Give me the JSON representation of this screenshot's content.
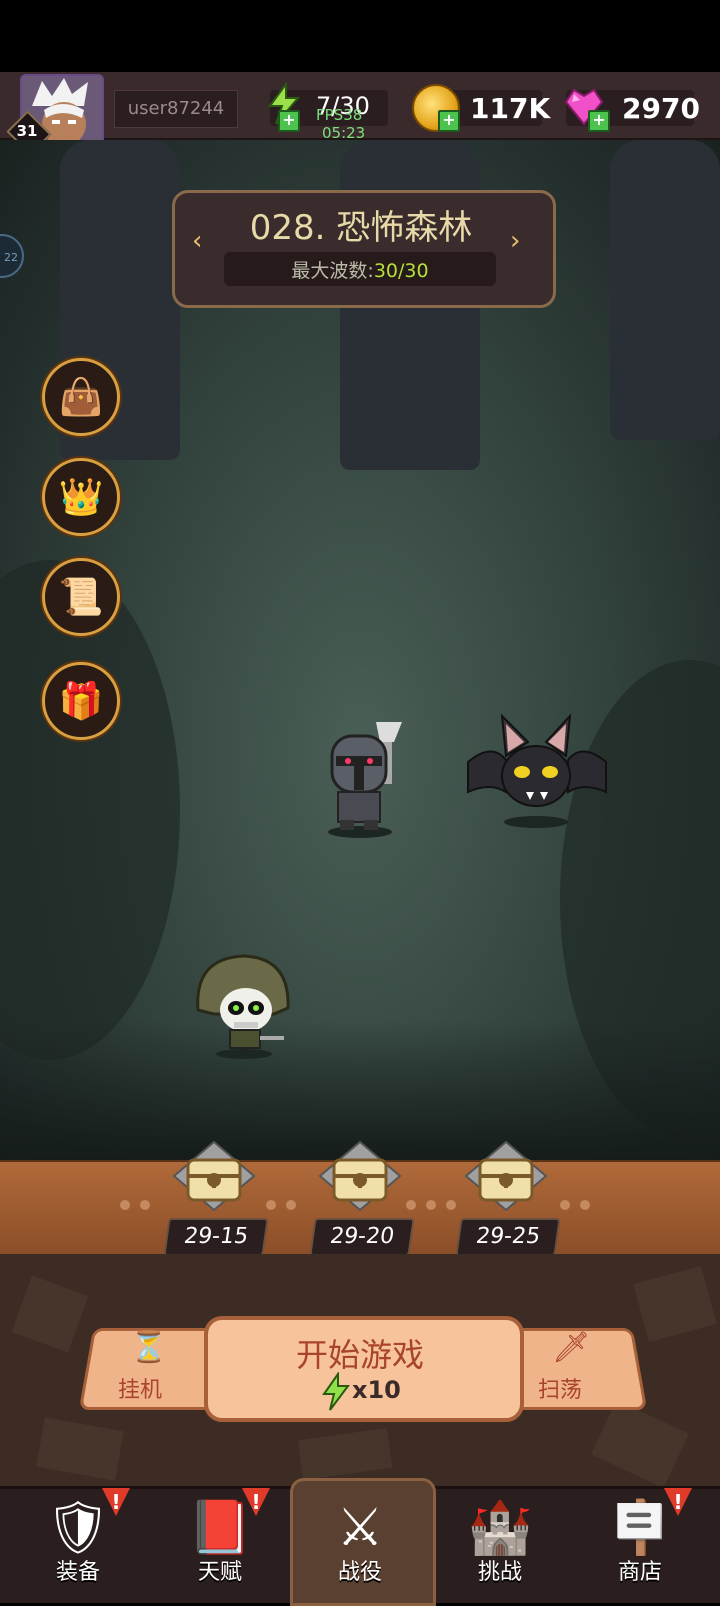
{
  "header": {
    "player_level": "31",
    "username": "user87244",
    "energy": "7/30",
    "fps": "FPS38",
    "energy_timer": "05:23",
    "coins": "117K",
    "gems": "2970"
  },
  "stage_info": {
    "name": "028. 恐怖森林",
    "wave_label": "最大波数:",
    "wave_value": "30/30",
    "side_indicator": "22"
  },
  "rewards": [
    {
      "label": "29-15"
    },
    {
      "label": "29-20"
    },
    {
      "label": "29-25"
    }
  ],
  "actions": {
    "idle_label": "挂机",
    "start_label": "开始游戏",
    "start_cost": "x10",
    "sweep_label": "扫荡"
  },
  "nav": [
    {
      "label": "装备",
      "icon": "armor-icon",
      "alert": "!"
    },
    {
      "label": "天赋",
      "icon": "talent-book-icon",
      "alert": "!"
    },
    {
      "label": "战役",
      "icon": "crossed-swords-icon",
      "alert": ""
    },
    {
      "label": "挑战",
      "icon": "dragon-castle-icon",
      "alert": ""
    },
    {
      "label": "商店",
      "icon": "shop-sign-icon",
      "alert": "!"
    }
  ],
  "colors": {
    "accent_green": "#b6e03a",
    "alert_red": "#e03a2a",
    "button_peach": "#f7c39a"
  }
}
